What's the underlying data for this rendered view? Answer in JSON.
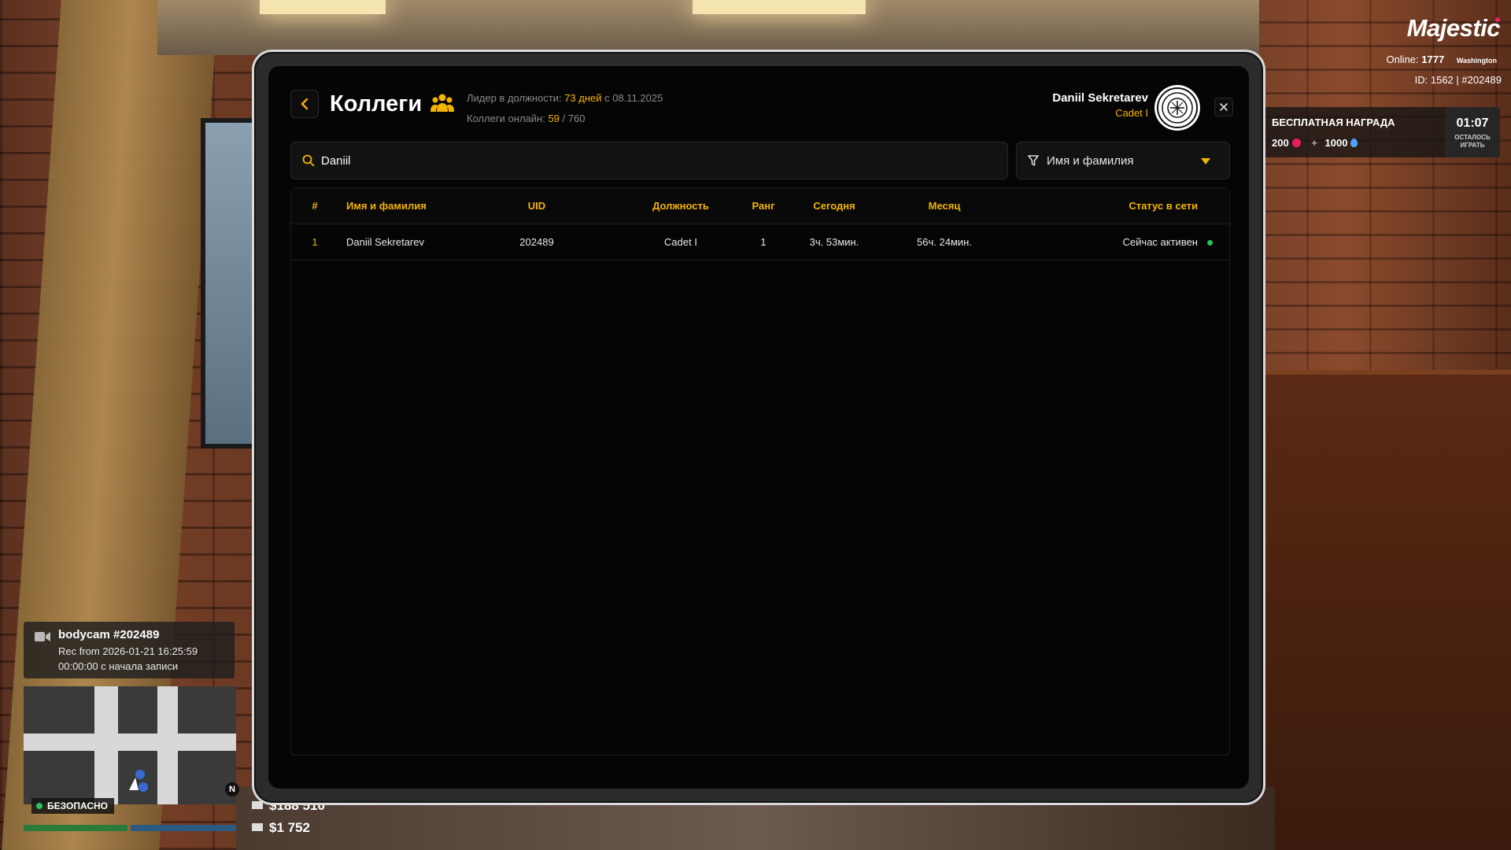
{
  "page": {
    "title": "Коллеги",
    "leader_label": "Лидер в должности:",
    "leader_days": "73 дней",
    "leader_since": "с 08.11.2025",
    "online_label": "Коллеги онлайн:",
    "online_count": "59",
    "online_total": "/ 760"
  },
  "user": {
    "name": "Daniil Sekretarev",
    "rank": "Cadet I"
  },
  "search": {
    "value": "Daniil"
  },
  "filter": {
    "selected": "Имя и фамилия"
  },
  "table": {
    "headers": {
      "idx": "#",
      "name": "Имя и фамилия",
      "uid": "UID",
      "position": "Должность",
      "rank": "Ранг",
      "today": "Сегодня",
      "month": "Месяц",
      "status": "Статус в сети"
    },
    "rows": [
      {
        "idx": "1",
        "name": "Daniil Sekretarev",
        "uid": "202489",
        "position": "Cadet I",
        "rank": "1",
        "today": "3ч. 53мин.",
        "month": "56ч. 24мин.",
        "status": "Сейчас активен"
      }
    ]
  },
  "hud": {
    "logo": "Majestic",
    "online_label": "Online:",
    "online_value": "1777",
    "server": "Washington",
    "id_line": "ID: 1562 | #202489",
    "reward_title": "БЕСПЛАТНАЯ НАГРАДА",
    "reward_coins": "200",
    "reward_plus": "+",
    "reward_drops": "1000",
    "reward_time": "01:07",
    "reward_sub_1": "ОСТАЛОСЬ",
    "reward_sub_2": "ИГРАТЬ",
    "bodycam_title": "bodycam #202489",
    "bodycam_line1": "Rec from 2026-01-21 16:25:59",
    "bodycam_line2": "00:00:00 с начала записи",
    "north": "N",
    "safe_zone": "БЕЗОПАСНО",
    "money_bank": "$188 510",
    "money_cash": "$1 752"
  },
  "colors": {
    "accent": "#f4b400",
    "status_online": "#22c55e",
    "panel_bg": "#050505"
  }
}
